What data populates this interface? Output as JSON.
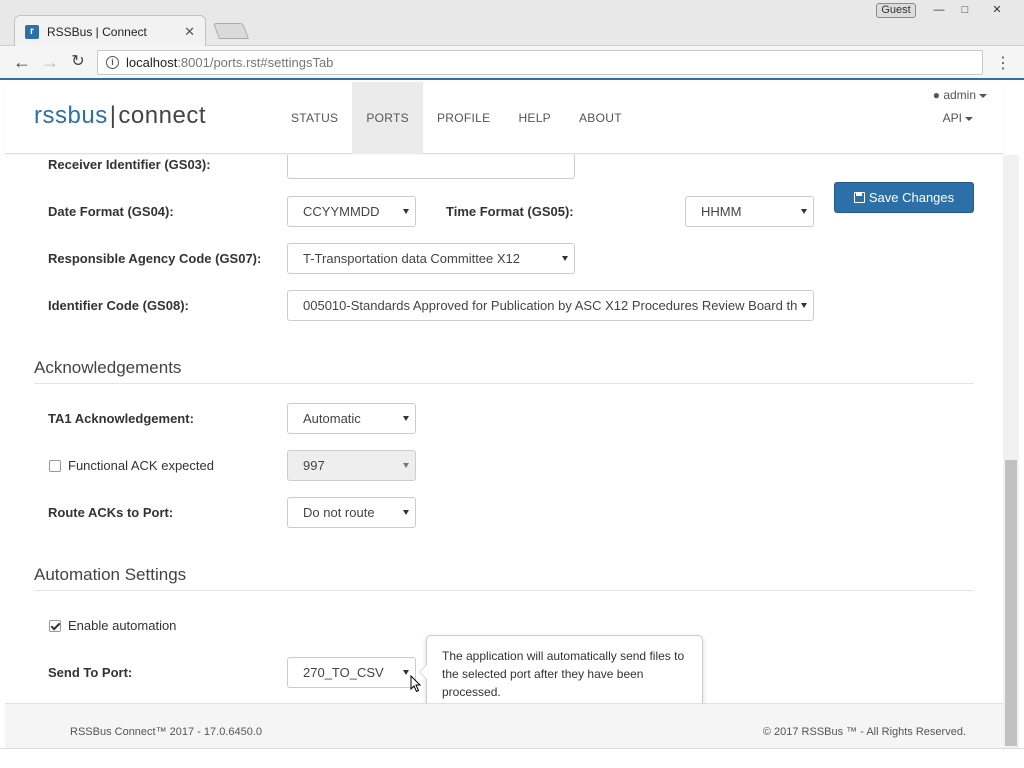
{
  "browser": {
    "tab_title": "RSSBus | Connect",
    "tab_close": "✕",
    "guest_label": "Guest",
    "url_host": "localhost",
    "url_path": ":8001/ports.rst#settingsTab",
    "min": "—",
    "max": "□",
    "close": "✕"
  },
  "header": {
    "logo_left": "rssbus",
    "logo_sep": "|",
    "logo_right": "connect",
    "nav": [
      "STATUS",
      "PORTS",
      "PROFILE",
      "HELP",
      "ABOUT"
    ],
    "active_nav": "PORTS",
    "user": "admin",
    "api": "API"
  },
  "form": {
    "receiver_id_label": "Receiver Identifier (GS03):",
    "receiver_id_value": "",
    "date_format_label": "Date Format (GS04):",
    "date_format_value": "CCYYMMDD",
    "time_format_label": "Time Format (GS05):",
    "time_format_value": "HHMM",
    "agency_label": "Responsible Agency Code (GS07):",
    "agency_value": "T-Transportation data Committee X12",
    "identifier_label": "Identifier Code (GS08):",
    "identifier_value": "005010-Standards Approved for Publication by ASC X12 Procedures Review Board th",
    "save_label": "Save Changes"
  },
  "ack": {
    "title": "Acknowledgements",
    "ta1_label": "TA1 Acknowledgement:",
    "ta1_value": "Automatic",
    "functional_label": "Functional ACK expected",
    "functional_checked": false,
    "functional_value": "997",
    "route_label": "Route ACKs to Port:",
    "route_value": "Do not route"
  },
  "automation": {
    "title": "Automation Settings",
    "enable_label": "Enable automation",
    "enable_checked": true,
    "send_label": "Send To Port:",
    "send_value": "270_TO_CSV",
    "tooltip": "The application will automatically send files to the selected port after they have been processed."
  },
  "footer": {
    "left": "RSSBus Connect™ 2017 - 17.0.6450.0",
    "right": "© 2017 RSSBus ™ - All Rights Reserved."
  },
  "colors": {
    "brand": "#2d6fa8",
    "active_nav_bg": "#ebebeb"
  }
}
